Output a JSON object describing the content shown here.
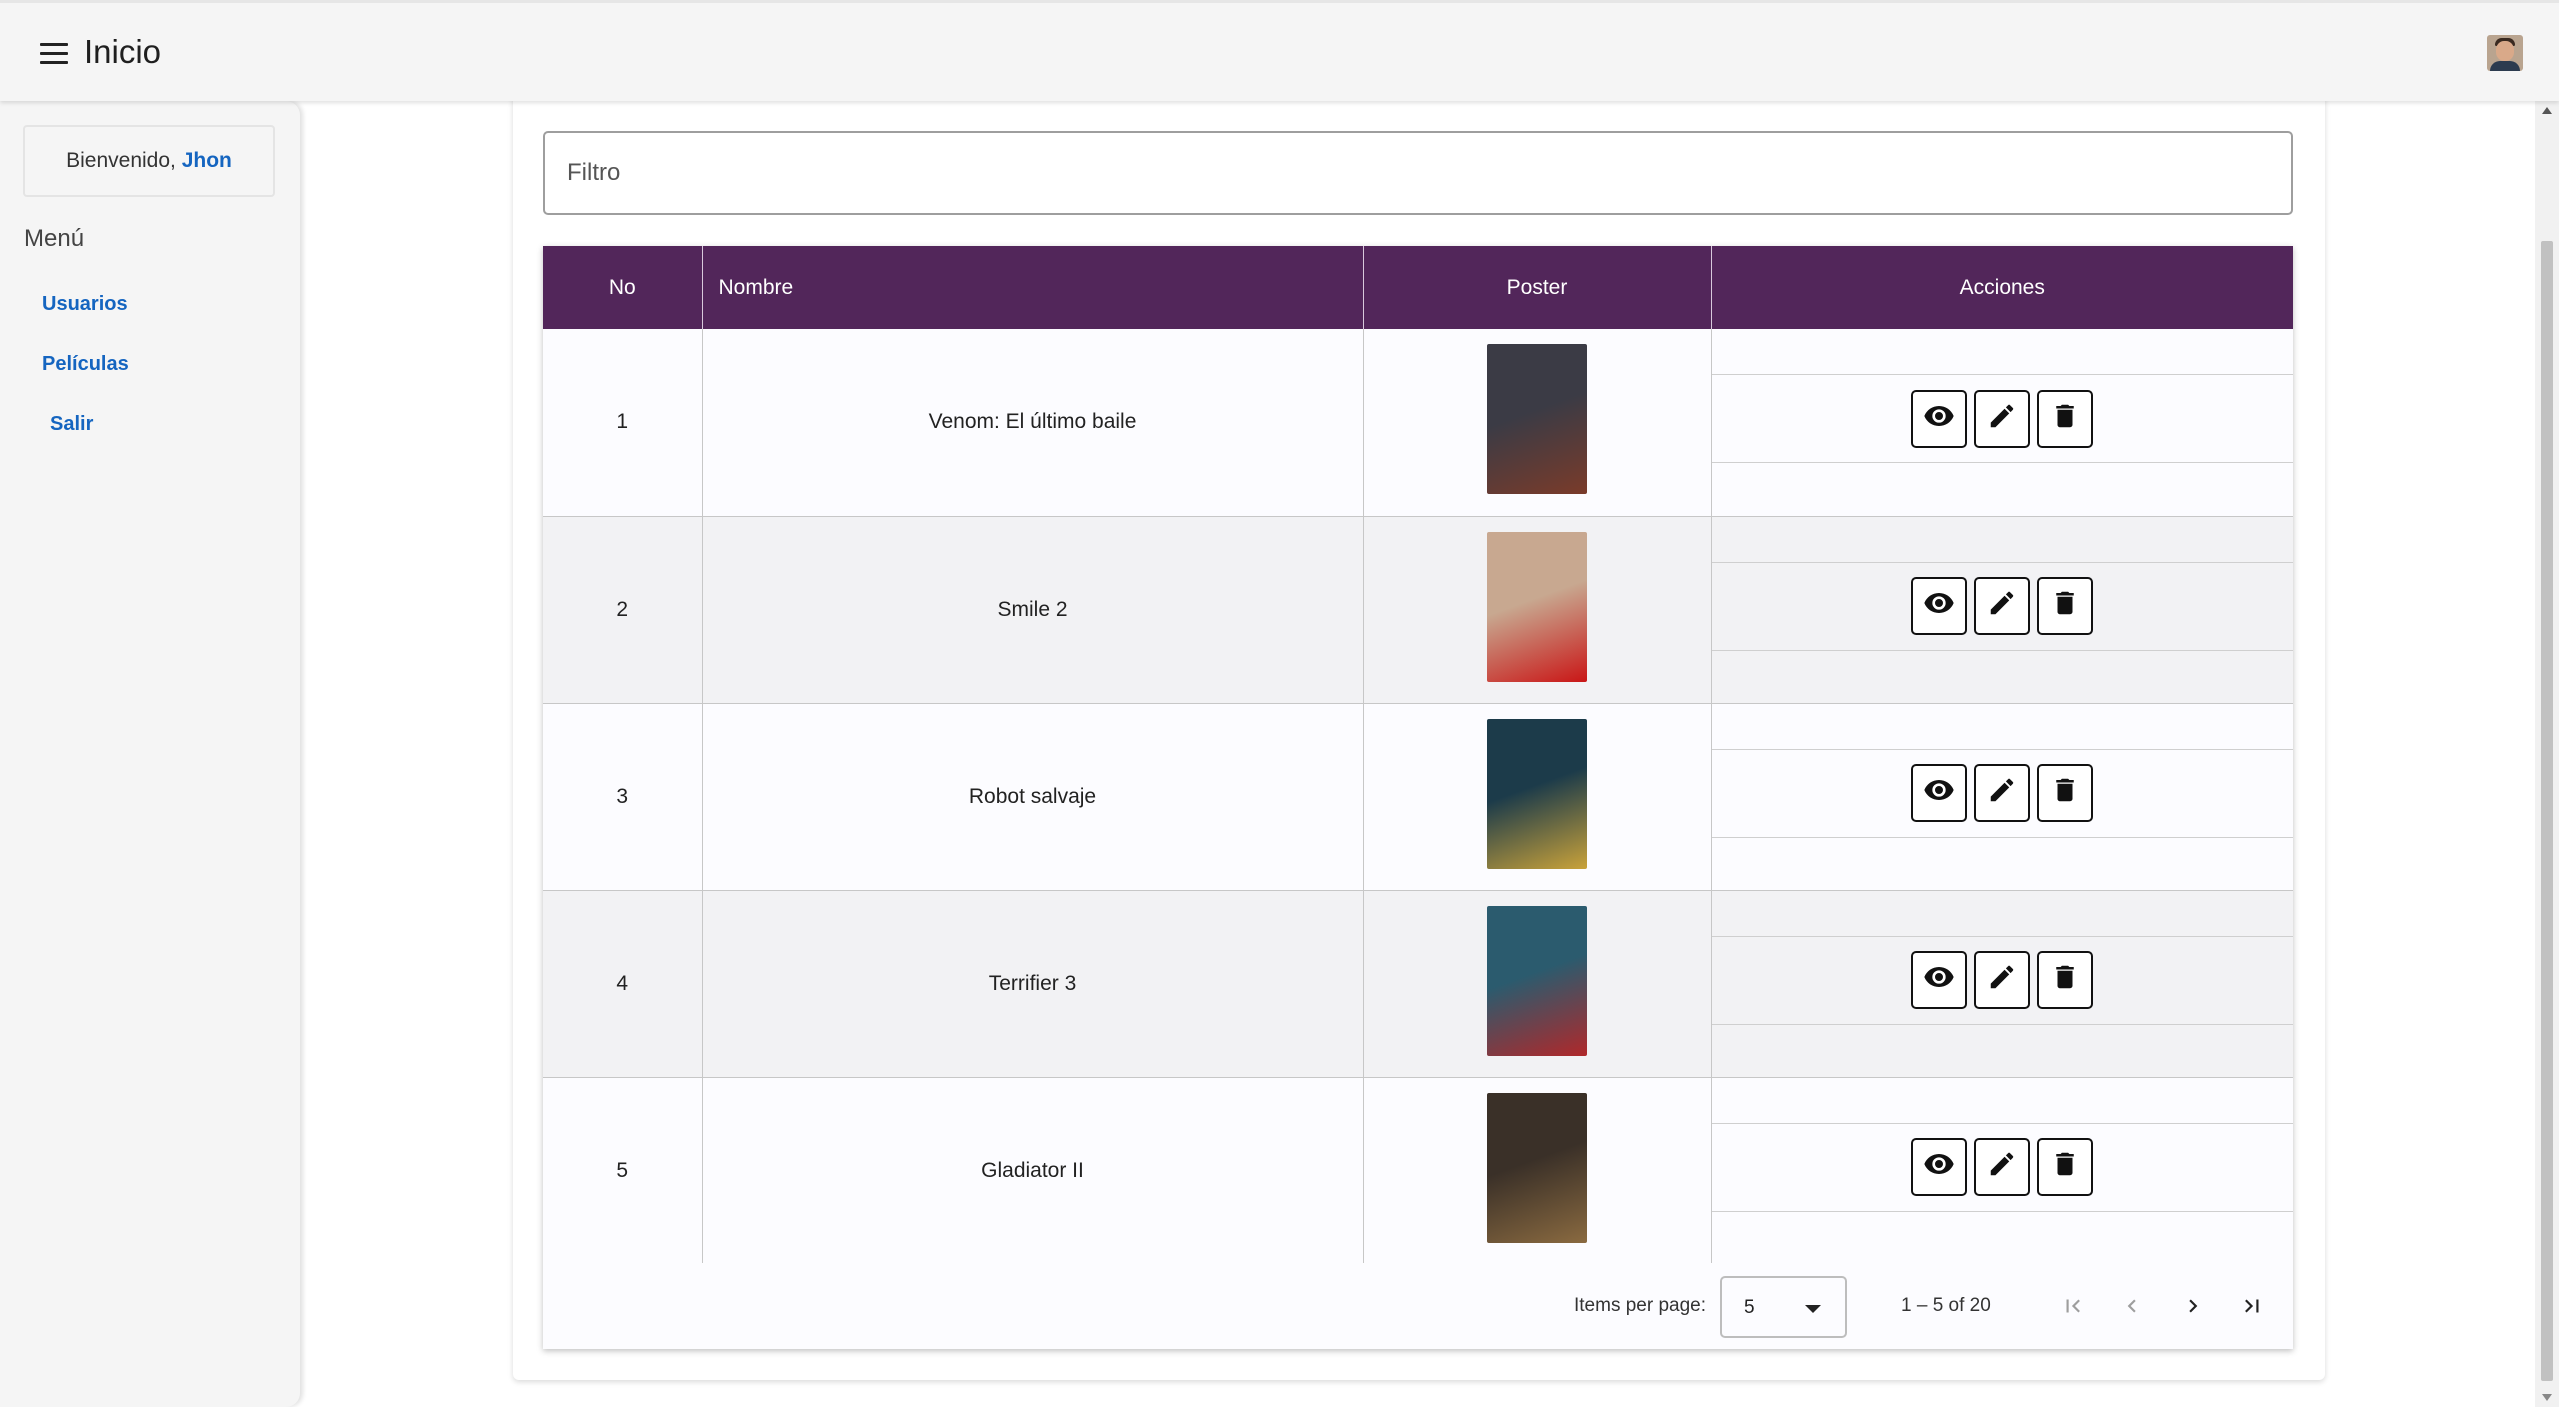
{
  "header": {
    "title": "Inicio"
  },
  "sidebar": {
    "welcome_prefix": "Bienvenido,",
    "user_name": "Jhon",
    "menu_title": "Menú",
    "items": [
      {
        "label": "Usuarios"
      },
      {
        "label": "Películas"
      },
      {
        "label": "Salir"
      }
    ]
  },
  "filter": {
    "placeholder": "Filtro",
    "value": ""
  },
  "table": {
    "columns": [
      "No",
      "Nombre",
      "Poster",
      "Acciones"
    ],
    "rows": [
      {
        "no": "1",
        "nombre": "Venom: El último baile",
        "poster_colors": [
          "#3b3b45",
          "#7a3b2a"
        ]
      },
      {
        "no": "2",
        "nombre": "Smile 2",
        "poster_colors": [
          "#c8a890",
          "#c91616"
        ]
      },
      {
        "no": "3",
        "nombre": "Robot salvaje",
        "poster_colors": [
          "#1c3b4a",
          "#c9a23a"
        ]
      },
      {
        "no": "4",
        "nombre": "Terrifier 3",
        "poster_colors": [
          "#2b5b6e",
          "#b0282a"
        ]
      },
      {
        "no": "5",
        "nombre": "Gladiator II",
        "poster_colors": [
          "#3a3028",
          "#8a6a40"
        ]
      }
    ],
    "action_icons": [
      "eye-icon",
      "pencil-icon",
      "trash-icon"
    ]
  },
  "paginator": {
    "items_per_page_label": "Items per page:",
    "items_per_page_value": "5",
    "range_label": "1 – 5 of 20",
    "buttons": [
      "first-page-icon",
      "previous-page-icon",
      "next-page-icon",
      "last-page-icon"
    ]
  },
  "colors": {
    "header_bg": "#52265a",
    "link": "#1565c0"
  }
}
